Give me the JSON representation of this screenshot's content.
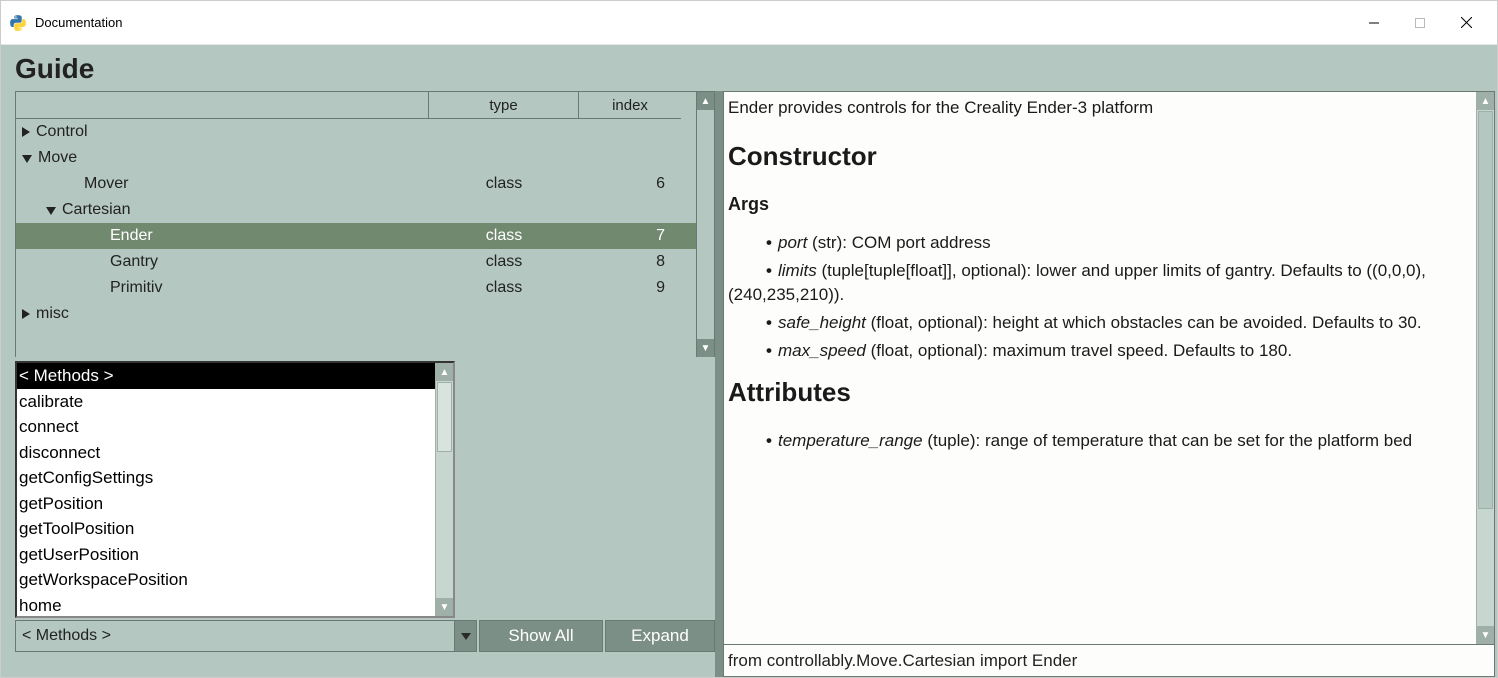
{
  "window": {
    "title": "Documentation"
  },
  "guide_title": "Guide",
  "tree": {
    "columns": {
      "name": "",
      "type": "type",
      "index": "index"
    },
    "rows": [
      {
        "name": "Control",
        "type": "",
        "index": "",
        "indent": 0,
        "arrow": "right",
        "selected": false
      },
      {
        "name": "Move",
        "type": "",
        "index": "",
        "indent": 0,
        "arrow": "down",
        "selected": false
      },
      {
        "name": "Mover",
        "type": "class",
        "index": "6",
        "indent": 2,
        "arrow": "none",
        "selected": false
      },
      {
        "name": "Cartesian",
        "type": "",
        "index": "",
        "indent": 1,
        "arrow": "down",
        "selected": false
      },
      {
        "name": "Ender",
        "type": "class",
        "index": "7",
        "indent": 3,
        "arrow": "none",
        "selected": true
      },
      {
        "name": "Gantry",
        "type": "class",
        "index": "8",
        "indent": 3,
        "arrow": "none",
        "selected": false
      },
      {
        "name": "Primitiv",
        "type": "class",
        "index": "9",
        "indent": 3,
        "arrow": "none",
        "selected": false
      },
      {
        "name": "misc",
        "type": "",
        "index": "",
        "indent": 0,
        "arrow": "right",
        "selected": false
      }
    ]
  },
  "methods": {
    "header": "< Methods >",
    "items": [
      "calibrate",
      "connect",
      "disconnect",
      "getConfigSettings",
      "getPosition",
      "getToolPosition",
      "getUserPosition",
      "getWorkspacePosition",
      "home"
    ]
  },
  "status_label": "< Methods >",
  "buttons": {
    "showall": "Show All",
    "expand": "Expand"
  },
  "doc": {
    "intro": "Ender provides controls for the Creality Ender-3 platform",
    "h_constructor": "Constructor",
    "h_args": "Args",
    "args": {
      "a0": {
        "name": "port",
        "type": "(str)",
        "desc": ": COM port address"
      },
      "a1": {
        "name": "limits",
        "type": "(tuple[tuple[float]], optional)",
        "desc": ": lower and upper limits of gantry. Defaults to ((0,0,0), (240,235,210))."
      },
      "a2": {
        "name": "safe_height",
        "type": "(float, optional)",
        "desc": ": height at which obstacles can be avoided. Defaults to 30."
      },
      "a3": {
        "name": "max_speed",
        "type": "(float, optional)",
        "desc": ": maximum travel speed. Defaults to 180."
      }
    },
    "h_attributes": "Attributes",
    "attrs": {
      "b0": {
        "name": "temperature_range",
        "type": "(tuple)",
        "desc": ": range of temperature that can be set for the platform bed"
      }
    }
  },
  "import_line": "from controllably.Move.Cartesian import Ender"
}
